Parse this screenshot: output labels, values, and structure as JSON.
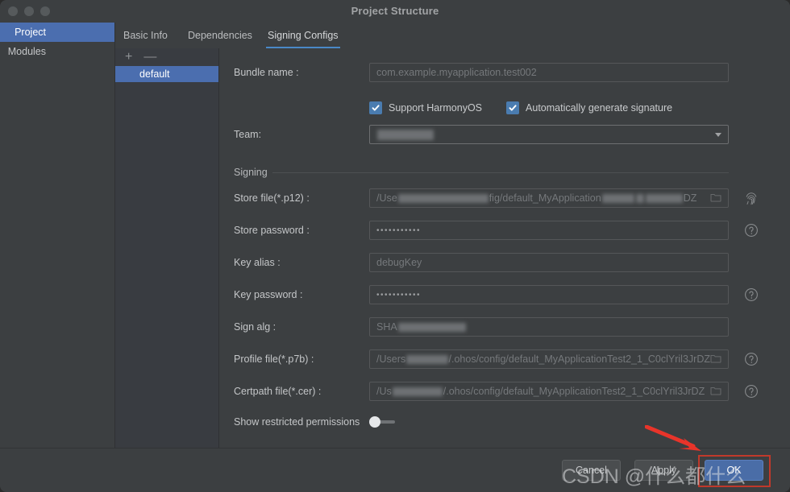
{
  "window": {
    "title": "Project Structure",
    "traffic_lights": [
      "close",
      "minimize",
      "zoom"
    ]
  },
  "sidebar": {
    "items": [
      {
        "label": "Project",
        "selected": true
      },
      {
        "label": "Modules",
        "selected": false
      }
    ]
  },
  "tabs": [
    {
      "label": "Basic Info",
      "active": false
    },
    {
      "label": "Dependencies",
      "active": false
    },
    {
      "label": "Signing Configs",
      "active": true
    }
  ],
  "config_list": {
    "add_label": "+",
    "remove_label": "—",
    "items": [
      {
        "label": "default",
        "selected": true
      }
    ]
  },
  "form": {
    "bundle_name": {
      "label": "Bundle name :",
      "value": "com.example.myapplication.test002"
    },
    "checkboxes": [
      {
        "label": "Support HarmonyOS",
        "checked": true
      },
      {
        "label": "Automatically generate signature",
        "checked": true
      }
    ],
    "team": {
      "label": "Team:",
      "value": "",
      "redacted": true
    },
    "signing_group_label": "Signing",
    "store_file": {
      "label": "Store file(*.p12) :",
      "value_prefix": "/Use",
      "value_mid": "fig/default_MyApplication",
      "value_suffix": "DZ",
      "redacted": true,
      "icon": "folder-icon",
      "side_icon": "fingerprint-icon"
    },
    "store_password": {
      "label": "Store password :",
      "value": "•••••••••••",
      "side_icon": "help-icon"
    },
    "key_alias": {
      "label": "Key alias :",
      "value": "debugKey"
    },
    "key_password": {
      "label": "Key password :",
      "value": "•••••••••••",
      "side_icon": "help-icon"
    },
    "sign_alg": {
      "label": "Sign alg :",
      "value_prefix": "SHA",
      "redacted": true
    },
    "profile_file": {
      "label": "Profile file(*.p7b) :",
      "value_prefix": "/Users",
      "value_suffix": "/.ohos/config/default_MyApplicationTest2_1_C0clYril3JrDZ",
      "redacted": true,
      "icon": "folder-icon",
      "side_icon": "help-icon"
    },
    "certpath_file": {
      "label": "Certpath file(*.cer) :",
      "value_prefix": "/Us",
      "value_suffix": "/.ohos/config/default_MyApplicationTest2_1_C0clYril3JrDZ",
      "redacted": true,
      "icon": "folder-icon",
      "side_icon": "help-icon"
    },
    "show_restricted": {
      "label": "Show restricted permissions",
      "enabled": false
    }
  },
  "footer": {
    "cancel": "Cancel",
    "apply": "Apply",
    "ok": "OK"
  },
  "annotation": {
    "highlight_target": "ok-button",
    "arrow_color": "#e8342a",
    "box_color": "#c0392b",
    "watermark": "CSDN @什么都什么"
  },
  "colors": {
    "window_bg": "#3c3f41",
    "panel_bg": "#393c41",
    "selection": "#4b6eaf",
    "tab_underline": "#4a88c7",
    "primary_button": "#4a6da7",
    "text": "#c4c6c8",
    "placeholder": "#75787b"
  }
}
